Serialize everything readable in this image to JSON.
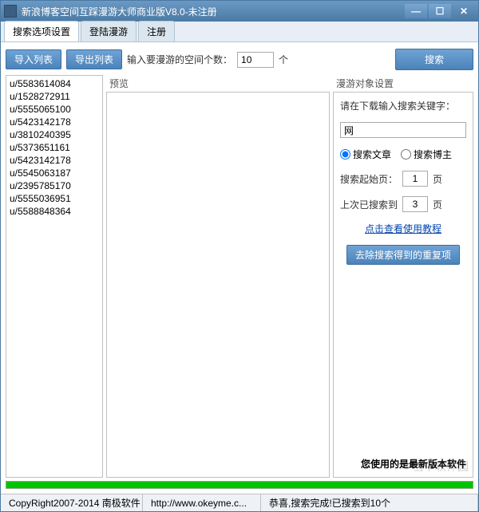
{
  "window": {
    "title": "新浪博客空间互踩漫游大师商业版V8.0-未注册"
  },
  "tabs": {
    "t1": "搜索选项设置",
    "t2": "登陆漫游",
    "t3": "注册"
  },
  "topbar": {
    "import_btn": "导入列表",
    "export_btn": "导出列表",
    "count_label": "输入要漫游的空间个数：",
    "count_value": "10",
    "count_suffix": "个",
    "search_btn": "搜索"
  },
  "list": {
    "items": [
      "u/5583614084",
      "u/1528272911",
      "u/5555065100",
      "u/5423142178",
      "u/3810240395",
      "u/5373651161",
      "u/5423142178",
      "u/5545063187",
      "u/2395785170",
      "u/5555036951",
      "u/5588848364"
    ]
  },
  "preview": {
    "label": "预览"
  },
  "right": {
    "legend": "漫游对象设置",
    "kw_label": "请在下载输入搜索关键字：",
    "kw_value": "网",
    "radio_article": "搜索文章",
    "radio_blogger": "搜索博主",
    "start_page_label": "搜索起始页：",
    "start_page_value": "1",
    "page_suffix": "页",
    "last_page_label": "上次已搜索到",
    "last_page_value": "3",
    "tutorial_link": "点击查看使用教程",
    "dedup_btn": "去除搜索得到的重复项",
    "version_txt": "您使用的是最新版本软件"
  },
  "status": {
    "copyright": "CopyRight2007-2014 南极软件",
    "url": "http://www.okeyme.c...",
    "msg": "恭喜,搜索完成!已搜索到10个"
  },
  "watermark": "当下软件园"
}
